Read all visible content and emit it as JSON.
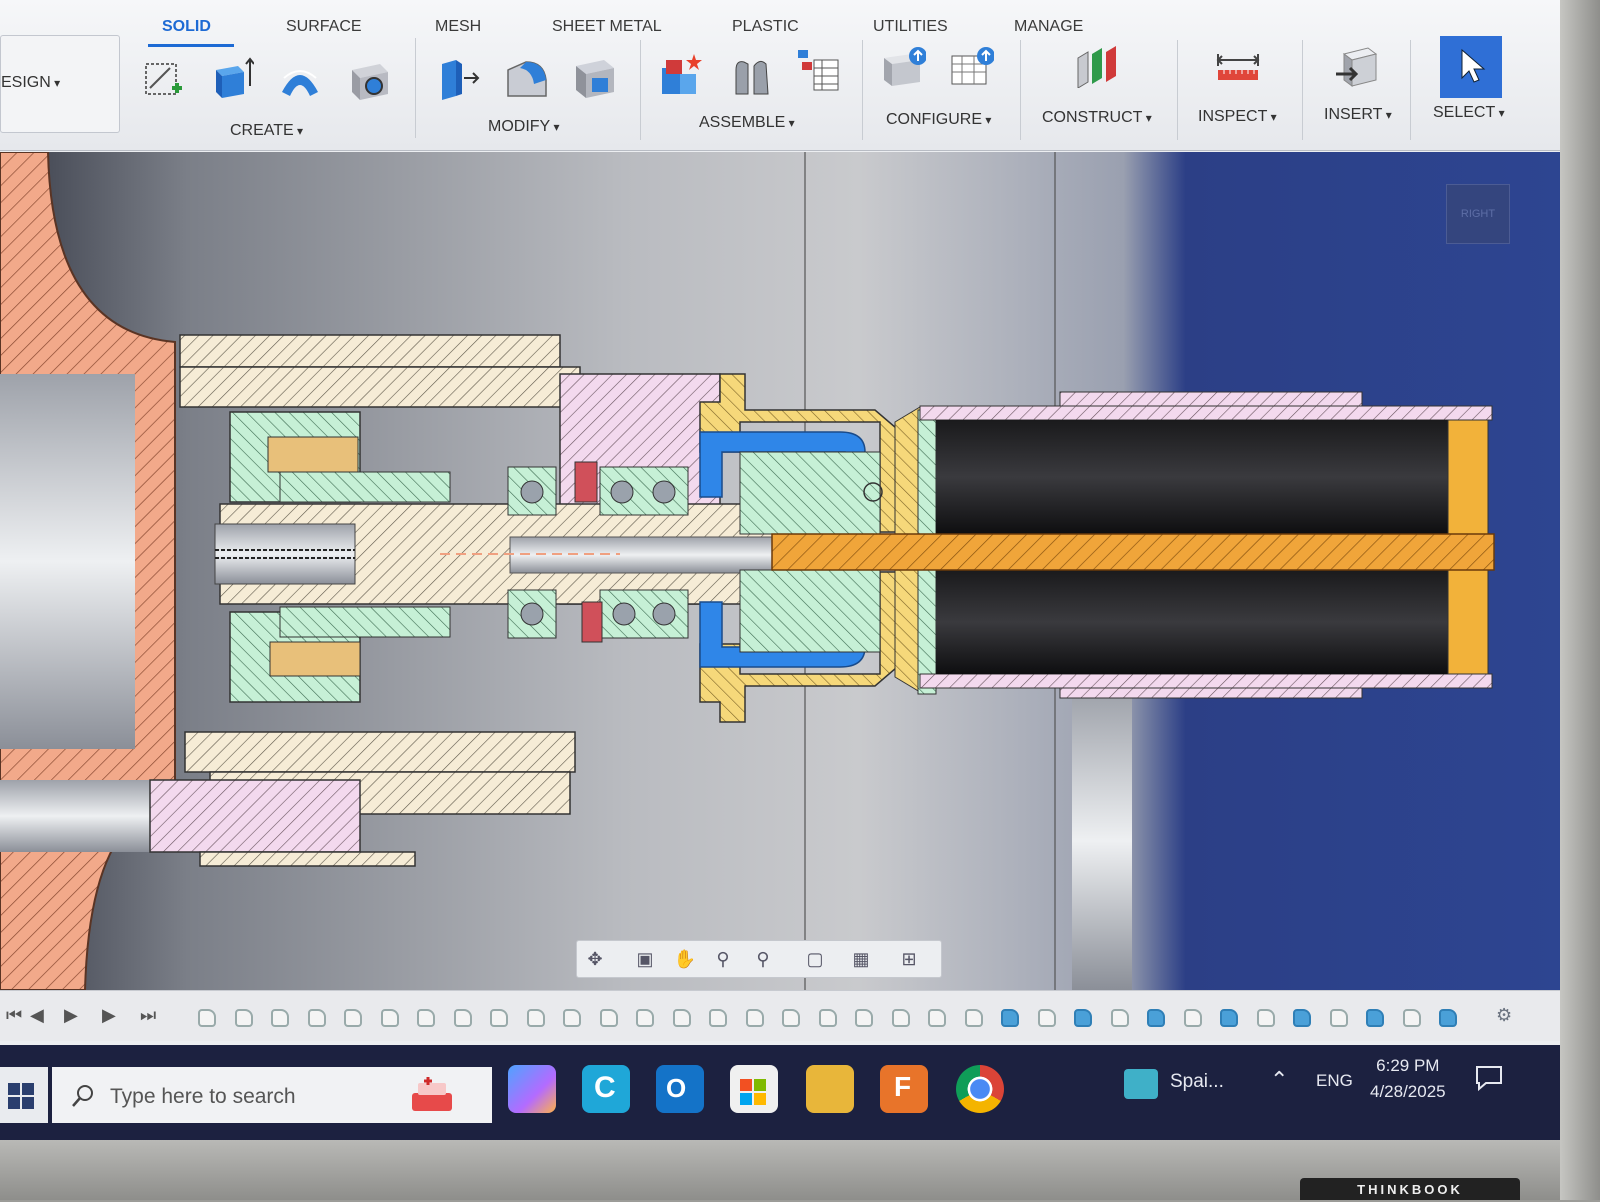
{
  "ribbon": {
    "tabs": [
      {
        "label": "SOLID",
        "active": true
      },
      {
        "label": "SURFACE"
      },
      {
        "label": "MESH"
      },
      {
        "label": "SHEET METAL"
      },
      {
        "label": "PLASTIC"
      },
      {
        "label": "UTILITIES"
      },
      {
        "label": "MANAGE"
      }
    ],
    "workspace_label": "ESIGN",
    "groups": {
      "create": "CREATE",
      "modify": "MODIFY",
      "assemble": "ASSEMBLE",
      "configure": "CONFIGURE",
      "construct": "CONSTRUCT",
      "inspect": "INSPECT",
      "insert": "INSERT",
      "select": "SELECT"
    }
  },
  "viewport": {
    "viewcube_label": "RIGHT"
  },
  "taskbar": {
    "search_placeholder": "Type here to search",
    "spotify_label": "Spai...",
    "language": "ENG",
    "time": "6:29 PM",
    "date": "4/28/2025"
  },
  "colors": {
    "accent": "#1d6ad4",
    "rod": "#f0a53a",
    "select_button": "#2f6fd6"
  },
  "bezel_logo": "THINKBOOK"
}
